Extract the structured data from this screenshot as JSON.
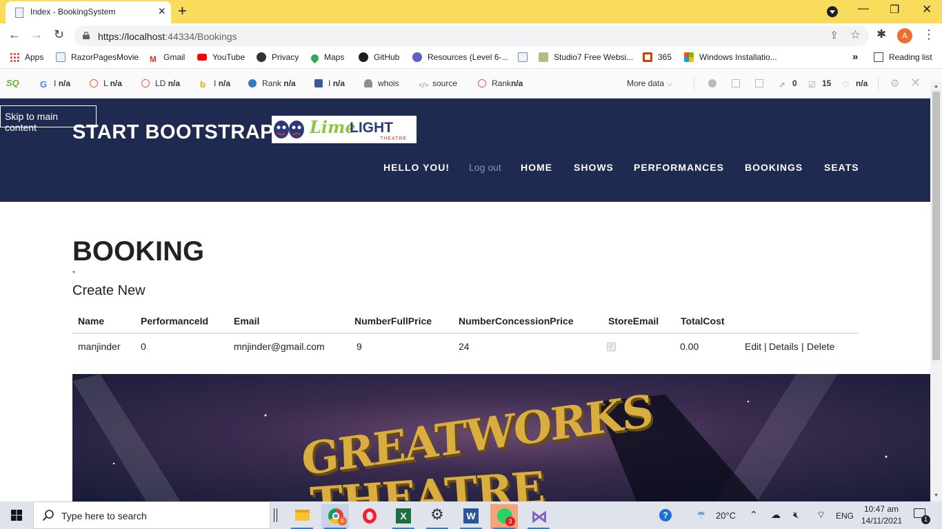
{
  "browser": {
    "tab_title": "Index - BookingSystem",
    "url_host": "https://localhost",
    "url_rest": ":44334/Bookings",
    "profile_initial": "A"
  },
  "bookmarks": [
    {
      "label": "Apps",
      "icon": "apps-grid-icon",
      "color": "#e8453c"
    },
    {
      "label": "RazorPagesMovie",
      "icon": "page-icon",
      "color": "#6d8fb7"
    },
    {
      "label": "Gmail",
      "icon": "gmail-icon",
      "color": "#d93025"
    },
    {
      "label": "YouTube",
      "icon": "youtube-icon",
      "color": "#ff0000"
    },
    {
      "label": "Privacy",
      "icon": "globe-icon",
      "color": "#333333"
    },
    {
      "label": "Maps",
      "icon": "maps-pin-icon",
      "color": "#34a853"
    },
    {
      "label": "GitHub",
      "icon": "github-icon",
      "color": "#1b1f23"
    },
    {
      "label": "Resources (Level 6-...",
      "icon": "teams-icon",
      "color": "#5b5fc7"
    },
    {
      "label": "",
      "icon": "page-icon",
      "color": "#6d8fb7"
    },
    {
      "label": "Studio7 Free Websi...",
      "icon": "site-icon",
      "color": "#8a8a5c"
    },
    {
      "label": "365",
      "icon": "office-icon",
      "color": "#d83b01"
    },
    {
      "label": "Windows Installatio...",
      "icon": "windows-logo-icon",
      "color": "#00a4ef"
    }
  ],
  "bookmarks_overflow": "»",
  "reading_list": "Reading list",
  "seoquake": {
    "items": [
      {
        "k": "I",
        "v": "n/a",
        "icon": "google-icon",
        "color": "#4285f4"
      },
      {
        "k": "L",
        "v": "n/a",
        "icon": "semrush-ring-icon",
        "color": "#e0603a"
      },
      {
        "k": "LD",
        "v": "n/a",
        "icon": "semrush-ring-icon",
        "color": "#e0603a"
      },
      {
        "k": "I",
        "v": "n/a",
        "icon": "bing-icon",
        "color": "#f0a30a"
      },
      {
        "k": "Rank",
        "v": "n/a",
        "icon": "alexa-icon",
        "color": "#2c7cc4"
      },
      {
        "k": "I",
        "v": "n/a",
        "icon": "facebook-icon",
        "color": "#3b5998"
      },
      {
        "k": "whois",
        "v": "",
        "icon": "person-icon",
        "color": "#8d8d8d"
      },
      {
        "k": "source",
        "v": "",
        "icon": "code-icon",
        "color": "#8d8d8d"
      },
      {
        "k": "Rank",
        "v": "n/a",
        "icon": "semrush-ring-icon",
        "color": "#e0603a"
      }
    ],
    "more_data": "More data",
    "right": [
      {
        "icon": "info-icon",
        "v": ""
      },
      {
        "icon": "monitor-icon",
        "v": ""
      },
      {
        "icon": "table-icon",
        "v": ""
      },
      {
        "icon": "external-link-icon",
        "v": "0"
      },
      {
        "icon": "checkbox-icon",
        "v": "15"
      },
      {
        "icon": "heart-icon",
        "v": "n/a"
      }
    ]
  },
  "site": {
    "skip_link": "Skip to main content",
    "brand": "START BOOTSTRAP",
    "logo_text_lime": "Lime",
    "logo_text_light": "LIGHT",
    "logo_sub": "THEATRE",
    "nav": {
      "hello": "HELLO YOU!",
      "logout": "Log out",
      "home": "HOME",
      "shows": "SHOWS",
      "performances": "PERFORMANCES",
      "bookings": "BOOKINGS",
      "seats": "SEATS"
    },
    "heading": "BOOKING",
    "asterisk": "*",
    "create_new": "Create New",
    "table": {
      "headers": [
        "Name",
        "PerformanceId",
        "Email",
        "NumberFullPrice",
        "NumberConcessionPrice",
        "StoreEmail",
        "TotalCost"
      ],
      "rows": [
        {
          "name": "manjinder",
          "performance_id": "0",
          "email": "mnjinder@gmail.com",
          "full_price": "9",
          "concession_price": "24",
          "store_email": true,
          "total_cost": "0.00",
          "edit": "Edit",
          "details": "Details",
          "delete": "Delete",
          "sep": "|"
        }
      ]
    },
    "hero_text_1": "GREATWORKS",
    "hero_text_2": "THEATRE"
  },
  "taskbar": {
    "search_placeholder": "Type here to search",
    "weather": "20°C",
    "language": "ENG",
    "time": "10:47 am",
    "date": "14/11/2021",
    "whatsapp_badge": "3",
    "notification_count": "1"
  }
}
